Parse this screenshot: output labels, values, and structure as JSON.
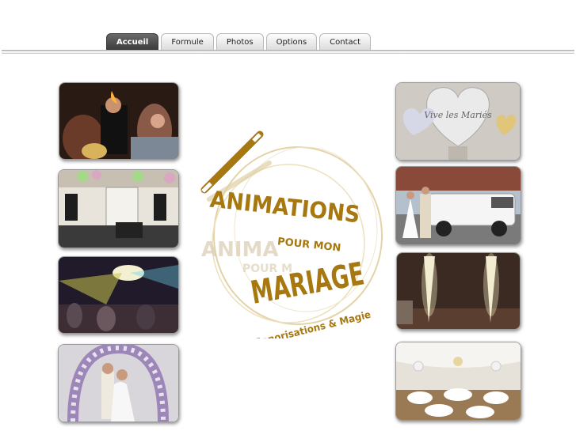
{
  "nav": {
    "tabs": [
      {
        "label": "Accueil",
        "active": true
      },
      {
        "label": "Formule",
        "active": false
      },
      {
        "label": "Photos",
        "active": false
      },
      {
        "label": "Options",
        "active": false
      },
      {
        "label": "Contact",
        "active": false
      }
    ]
  },
  "logo": {
    "line1": "ANIMATIONS",
    "line2": "POUR MON",
    "line3": "MARIAGE",
    "line4": "Sonorisations & Magie",
    "color": "#a6780f"
  },
  "balloon_text": "Vive les Mariés",
  "colors": {
    "tab_active": "#4a4a4a",
    "gold": "#a6780f"
  }
}
